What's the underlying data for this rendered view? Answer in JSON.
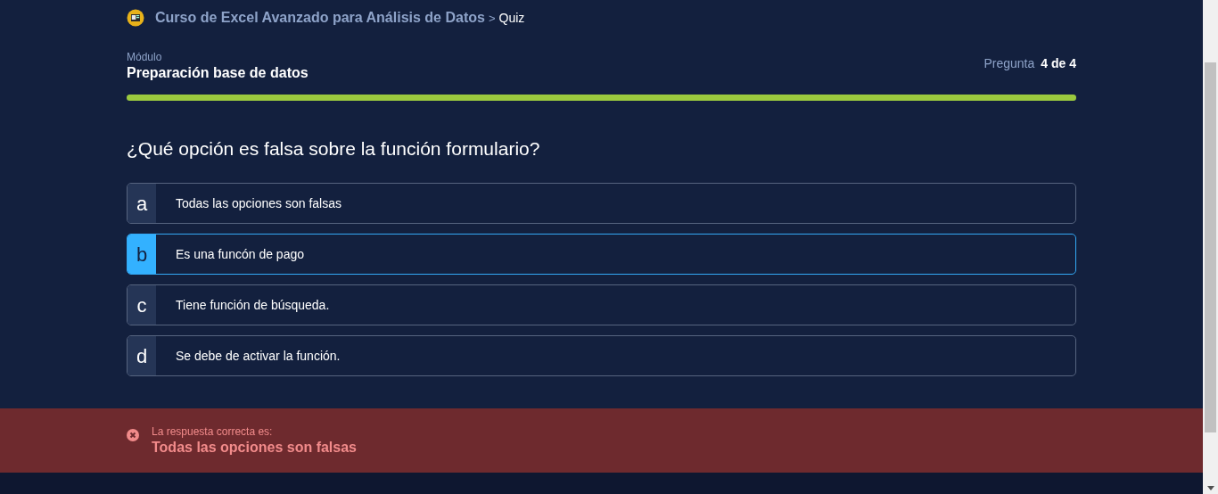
{
  "breadcrumb": {
    "course": "Curso de Excel Avanzado para Análisis de Datos",
    "separator": ">",
    "current": "Quiz"
  },
  "module": {
    "label": "Módulo",
    "name": "Preparación base de datos"
  },
  "progress": {
    "label": "Pregunta",
    "count": "4 de 4",
    "level": 1
  },
  "question": "¿Qué opción es falsa sobre la función formulario?",
  "options": [
    {
      "letter": "a",
      "text": "Todas las opciones son falsas",
      "selected": false
    },
    {
      "letter": "b",
      "text": "Es una funcón de pago",
      "selected": true
    },
    {
      "letter": "c",
      "text": "Tiene función de búsqueda.",
      "selected": false
    },
    {
      "letter": "d",
      "text": "Se debe de activar la función.",
      "selected": false
    }
  ],
  "feedback": {
    "correct": false,
    "label": "La respuesta correcta es:",
    "answer": "Todas las opciones son falsas"
  }
}
